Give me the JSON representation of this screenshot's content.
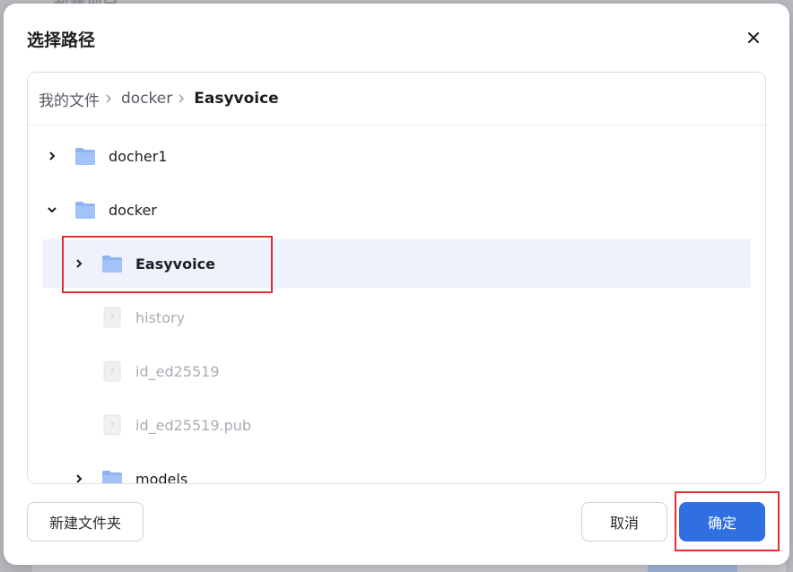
{
  "background": {
    "top_text": "新建项目"
  },
  "dialog": {
    "title": "选择路径",
    "close_icon": "close-icon"
  },
  "breadcrumb": {
    "items": [
      "我的文件",
      "docker",
      "Easyvoice"
    ]
  },
  "tree": {
    "rows": [
      {
        "label": "docher1",
        "type": "folder",
        "expander": "collapsed"
      },
      {
        "label": "docker",
        "type": "folder",
        "expander": "expanded"
      },
      {
        "label": "Easyvoice",
        "type": "folder",
        "expander": "collapsed",
        "selected": true
      },
      {
        "label": "history",
        "type": "file"
      },
      {
        "label": "id_ed25519",
        "type": "file"
      },
      {
        "label": "id_ed25519.pub",
        "type": "file"
      },
      {
        "label": "models",
        "type": "folder",
        "expander": "collapsed"
      }
    ]
  },
  "footer": {
    "new_folder_label": "新建文件夹",
    "cancel_label": "取消",
    "confirm_label": "确定"
  },
  "colors": {
    "primary": "#2f6fe0",
    "folder": "#8eb4f5",
    "selected_row": "#edf2fd",
    "annotation_red": "#e03131"
  }
}
